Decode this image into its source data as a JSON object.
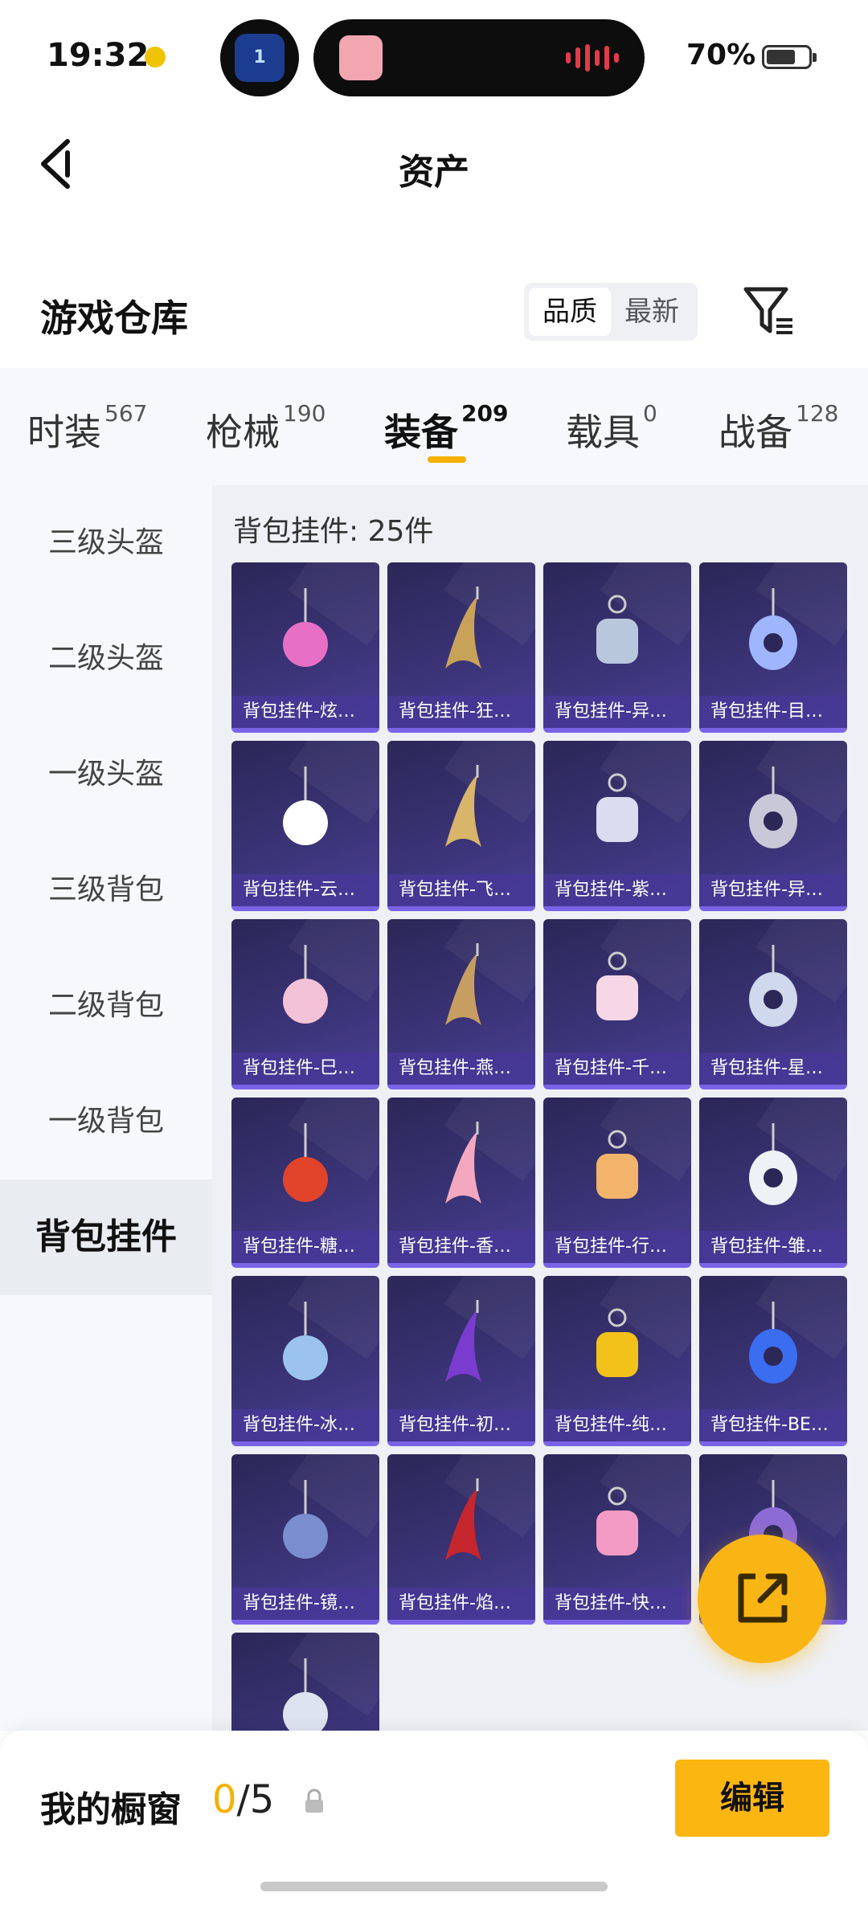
{
  "status_bar": {
    "time": "19:32",
    "battery": "70%",
    "battery_level": 0.7,
    "island_badge": "1"
  },
  "nav": {
    "title": "资产"
  },
  "section": {
    "title": "游戏仓库",
    "sort_options": [
      "品质",
      "最新"
    ],
    "sort_selected": "品质"
  },
  "tabs": [
    {
      "label": "时装",
      "count": "567"
    },
    {
      "label": "枪械",
      "count": "190"
    },
    {
      "label": "装备",
      "count": "209",
      "active": true
    },
    {
      "label": "载具",
      "count": "0"
    },
    {
      "label": "战备",
      "count": "128"
    }
  ],
  "sidebar": {
    "items": [
      "三级头盔",
      "二级头盔",
      "一级头盔",
      "三级背包",
      "二级背包",
      "一级背包",
      "背包挂件"
    ],
    "active": "背包挂件"
  },
  "grid": {
    "count_text": "背包挂件: 25件",
    "items": [
      "背包挂件-炫…",
      "背包挂件-狂…",
      "背包挂件-异…",
      "背包挂件-目…",
      "背包挂件-云…",
      "背包挂件-飞…",
      "背包挂件-紫…",
      "背包挂件-异…",
      "背包挂件-巳…",
      "背包挂件-燕…",
      "背包挂件-千…",
      "背包挂件-星…",
      "背包挂件-糖…",
      "背包挂件-香…",
      "背包挂件-行…",
      "背包挂件-雏…",
      "背包挂件-冰…",
      "背包挂件-初…",
      "背包挂件-纯…",
      "背包挂件-BE…",
      "背包挂件-镜…",
      "背包挂件-焰…",
      "背包挂件-快…",
      "",
      ""
    ]
  },
  "showcase": {
    "title": "我的橱窗",
    "current": "0",
    "total": "/5",
    "edit_label": "编辑"
  },
  "colors": {
    "accent": "#f5b000",
    "card_bg": "#3b3478",
    "card_label_bg": "#4a3796"
  },
  "icons": [
    "back-arrow-icon",
    "filter-icon",
    "lock-icon",
    "share-icon",
    "signal-icon",
    "battery-icon"
  ]
}
